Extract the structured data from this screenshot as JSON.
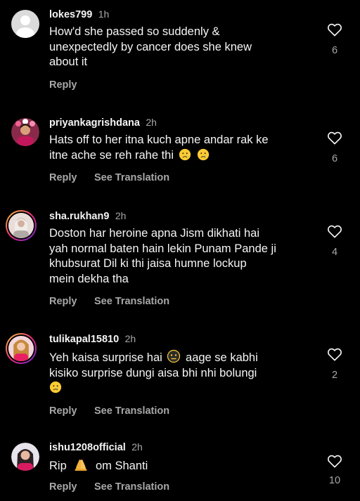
{
  "comments": [
    {
      "username": "lokes799",
      "time": "1h",
      "lines": [
        "How'd she passed so suddenly &",
        "unexpectedly by cancer does she knew",
        "about it"
      ],
      "reply_label": "Reply",
      "likes": "6"
    },
    {
      "username": "priyankagrishdana",
      "time": "2h",
      "lines": [
        "Hats off to her itna kuch apne andar rak ke",
        "itne ache se reh  rahe thi"
      ],
      "emojis": [
        "crying-face",
        "crying-face"
      ],
      "reply_label": "Reply",
      "translation_label": "See Translation",
      "likes": "6"
    },
    {
      "username": "sha.rukhan9",
      "time": "2h",
      "lines": [
        "Doston har heroine apna Jism dikhati hai",
        "yah normal baten hain lekin Punam Pande ji",
        "khubsurat Dil ki thi jaisa humne lockup",
        "mein dekha tha"
      ],
      "reply_label": "Reply",
      "translation_label": "See Translation",
      "likes": "4"
    },
    {
      "username": "tulikapal15810",
      "time": "2h",
      "lines": [
        "Yeh kaisa surprise hai",
        "aage se kabhi",
        "kisiko surprise dungi aisa bhi nhi bolungi"
      ],
      "emojis": [
        "neutral-face",
        "crying-face"
      ],
      "reply_label": "Reply",
      "translation_label": "See Translation",
      "likes": "2"
    },
    {
      "username": "ishu1208official",
      "time": "2h",
      "lines": [
        "Rip",
        "om Shanti"
      ],
      "emojis": [
        "folded-hands"
      ],
      "reply_label": "Reply",
      "translation_label": "See Translation",
      "likes": "10"
    }
  ],
  "icons": {
    "like": "heart-outline-icon",
    "avatar_default": "default-avatar-icon"
  },
  "colors": {
    "background": "#000000",
    "primary_text": "#f5f5f5",
    "secondary_text": "#a8a8a8",
    "story_ring": "#ee2a7b"
  }
}
